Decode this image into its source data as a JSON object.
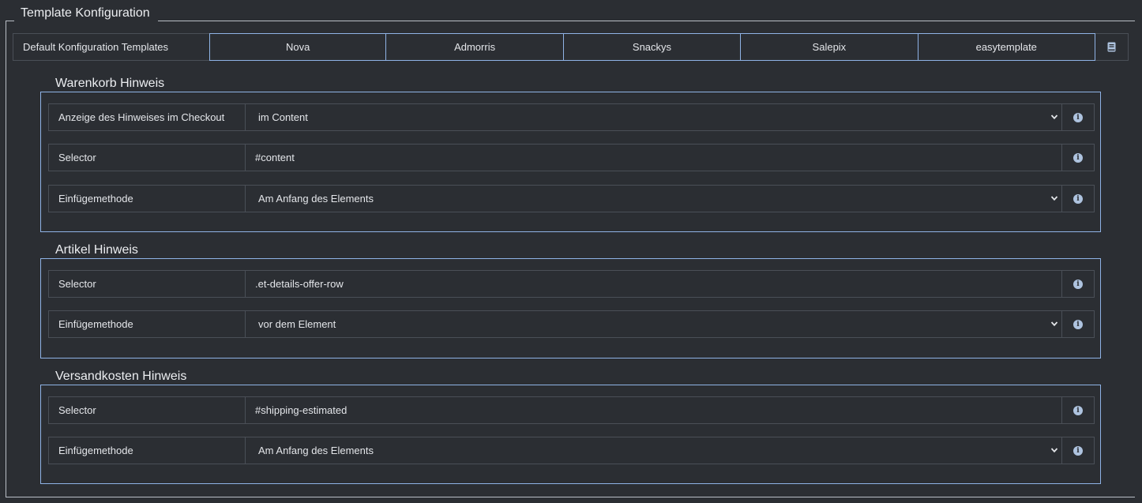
{
  "title": "Template Konfiguration",
  "templates": {
    "label": "Default Konfiguration Templates",
    "buttons": [
      "Nova",
      "Admorris",
      "Snackys",
      "Salepix",
      "easytemplate"
    ],
    "extra_icon": "book-icon"
  },
  "sections": [
    {
      "title": "Warenkorb Hinweis",
      "rows": [
        {
          "label": "Anzeige des Hinweises im Checkout",
          "value": "im Content",
          "type": "select"
        },
        {
          "label": "Selector",
          "value": "#content",
          "type": "input"
        },
        {
          "label": "Einfügemethode",
          "value": "Am Anfang des Elements",
          "type": "select"
        }
      ]
    },
    {
      "title": "Artikel Hinweis",
      "rows": [
        {
          "label": "Selector",
          "value": ".et-details-offer-row",
          "type": "input"
        },
        {
          "label": "Einfügemethode",
          "value": "vor dem Element",
          "type": "select"
        }
      ]
    },
    {
      "title": "Versandkosten Hinweis",
      "rows": [
        {
          "label": "Selector",
          "value": "#shipping-estimated",
          "type": "input"
        },
        {
          "label": "Einfügemethode",
          "value": "Am Anfang des Elements",
          "type": "select"
        }
      ]
    }
  ],
  "colors": {
    "background": "#2b2e33",
    "accent_border": "#8fb3e6",
    "info_icon": "#aec3df"
  }
}
